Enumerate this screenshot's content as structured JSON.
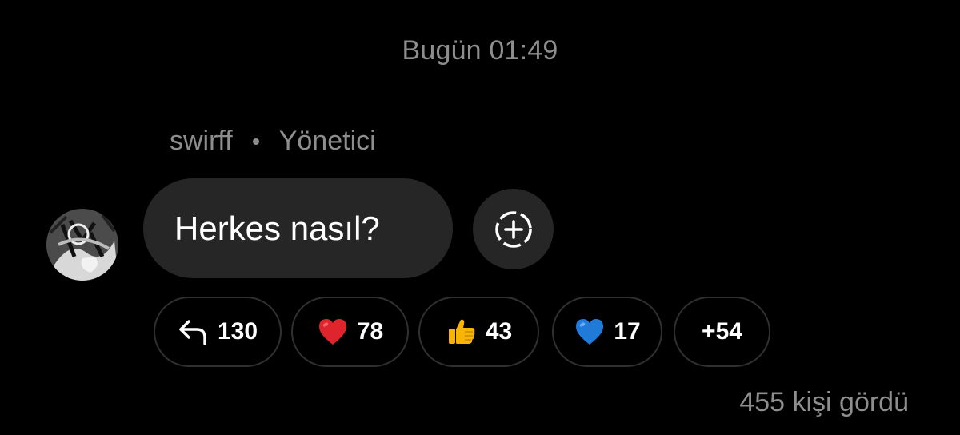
{
  "thread": {
    "timestamp": "Bugün 01:49"
  },
  "message": {
    "sender": "swirff",
    "role": "Yönetici",
    "text": "Herkes nasıl?",
    "avatar_icon": "avatar-image",
    "add_reaction_icon": "add-reaction-icon"
  },
  "reactions": [
    {
      "icon": "reply-icon",
      "count": "130"
    },
    {
      "icon": "red-heart-icon",
      "count": "78",
      "color": "#e0242e"
    },
    {
      "icon": "thumbs-up-icon",
      "count": "43",
      "color": "#f7b500"
    },
    {
      "icon": "blue-heart-icon",
      "count": "17",
      "color": "#1f7ad8"
    },
    {
      "icon": "",
      "count": "+54"
    }
  ],
  "seen_by": "455 kişi gördü"
}
